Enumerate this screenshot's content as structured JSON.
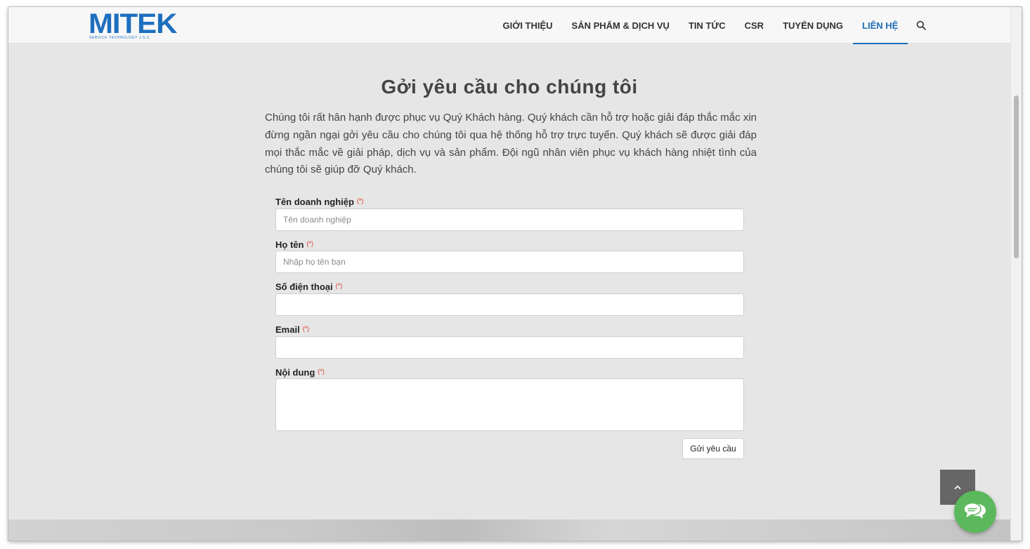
{
  "brand": {
    "logo_text": "MITEK",
    "logo_tagline": "SERVICE TECHNOLOGY J.S.C",
    "color": "#1f6fbf"
  },
  "nav": {
    "items": [
      {
        "label": "GIỚI THIỆU"
      },
      {
        "label": "SẢN PHẨM & DỊCH VỤ"
      },
      {
        "label": "TIN TỨC"
      },
      {
        "label": "CSR"
      },
      {
        "label": "TUYỂN DỤNG"
      },
      {
        "label": "LIÊN HỆ"
      }
    ],
    "active_index": 5,
    "active_color": "#1e6fb8",
    "search_icon": "search-icon"
  },
  "main": {
    "title": "Gởi yêu cầu cho chúng tôi",
    "intro": "Chúng tôi rất hân hạnh được phục vụ Quý Khách hàng. Quý khách cần hỗ trợ hoặc giải đáp thắc mắc xin đừng ngần ngại gởi yêu cầu cho chúng tôi qua hệ thống hỗ trợ trực tuyến. Quý khách sẽ được giải đáp mọi thắc mắc về giải pháp, dịch vụ và sản phẩm. Đội ngũ nhân viên phục vụ khách hàng nhiệt tình của chúng tôi sẽ giúp đỡ Quý khách."
  },
  "form": {
    "required_mark": "(*)",
    "company": {
      "label": "Tên doanh nghiệp",
      "placeholder": "Tên doanh nghiệp",
      "value": ""
    },
    "fullname": {
      "label": "Họ tên",
      "placeholder": "Nhập họ tên bạn",
      "value": ""
    },
    "phone": {
      "label": "Số điện thoại",
      "placeholder": "",
      "value": ""
    },
    "email": {
      "label": "Email",
      "placeholder": "",
      "value": ""
    },
    "content": {
      "label": "Nội dung",
      "placeholder": "",
      "value": ""
    },
    "submit_label": "Gửi yêu cầu"
  },
  "widgets": {
    "back_to_top_icon": "chevron-up-icon",
    "chat_icon": "chat-bubbles-icon",
    "chat_color": "#5cb85c"
  }
}
